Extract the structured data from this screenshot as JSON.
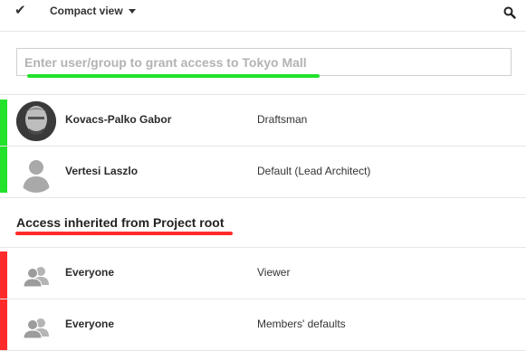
{
  "toolbar": {
    "check_icon": "check-icon",
    "compact_label": "Compact view",
    "search_icon": "search-icon"
  },
  "grant_input": {
    "placeholder": "Enter user/group to grant access to Tokyo Mall",
    "value": ""
  },
  "direct_access": [
    {
      "name": "Kovacs-Palko Gabor",
      "role": "Draftsman",
      "avatar": "user-photo"
    },
    {
      "name": "Vertesi Laszlo",
      "role": "Default  (Lead Architect)",
      "avatar": "user-silhouette-icon"
    }
  ],
  "inherited": {
    "title": "Access inherited from Project root",
    "rows": [
      {
        "name": "Everyone",
        "role": "Viewer",
        "avatar": "group-icon"
      },
      {
        "name": "Everyone",
        "role": "Members' defaults",
        "avatar": "group-icon"
      }
    ]
  },
  "colors": {
    "direct_highlight": "#22e22b",
    "inherited_highlight": "#ff2a2a",
    "icon_gray": "#a9a9a9"
  }
}
